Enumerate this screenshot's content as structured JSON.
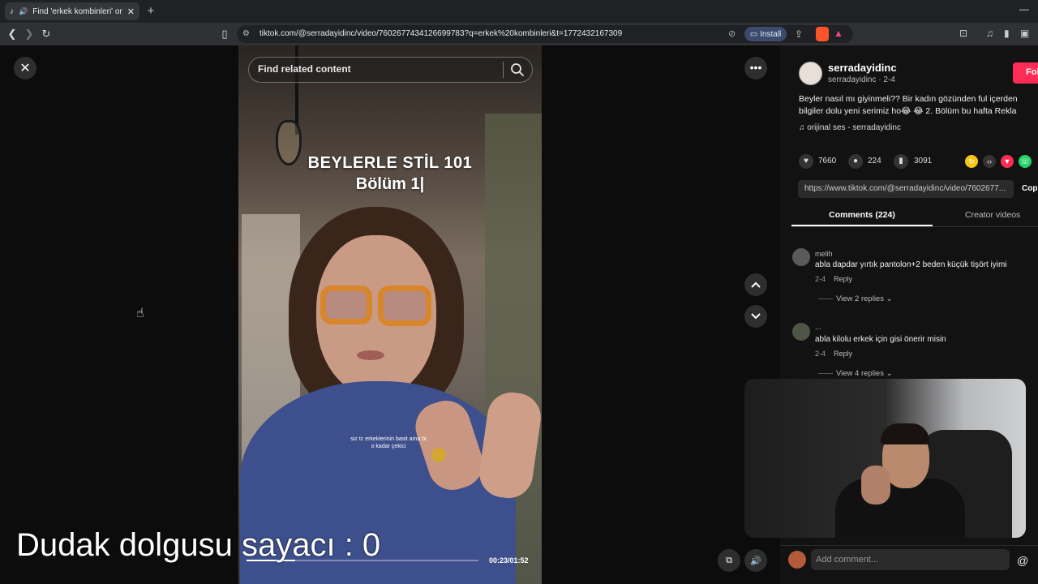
{
  "browser": {
    "tab_title": "Find 'erkek kombinleri' on Tik",
    "new_tab": "+",
    "minimize": "—",
    "url": "tiktok.com/@serradayidinc/video/7602677434126699783?q=erkek%20kombinleri&t=1772432167309",
    "install_label": "Install"
  },
  "search": {
    "placeholder": "Find related content"
  },
  "video": {
    "title_line1": "BEYLERLE STİL 101",
    "title_line2": "Bölüm 1|",
    "subtitle_line1": "siz tc erkeklerinin basit ama bi",
    "subtitle_line2": "o kadar çekici",
    "timecode": "00:23/01:52",
    "progress": 0.21
  },
  "overlay": {
    "text": "Dudak dolgusu  sayacı : 0"
  },
  "creator": {
    "username": "serradayidinc",
    "handle": "serradayidinc · 2-4",
    "follow_label": "Fol",
    "description_line1": "Beyler nasıl mı giyinmeli?? Bir kadın gözünden ful içerden",
    "description_line2": "bilgiler dolu yeni serimiz ho😂 😂 2. Bölüm bu hafta Rekla",
    "music": "♫  orijinal ses - serradayidinc"
  },
  "stats": {
    "likes": "7660",
    "comments": "224",
    "saves": "3091"
  },
  "share": {
    "link": "https://www.tiktok.com/@serradayidinc/video/7602677...",
    "copy_label": "Cop"
  },
  "tabs": {
    "comments": "Comments (224)",
    "creator": "Creator videos"
  },
  "comments": [
    {
      "name": "melih",
      "text": "abla dapdar yırtık pantolon+2 beden küçük tişört iyimi",
      "date": "2-4",
      "reply": "Reply",
      "view_replies": "View 2 replies ⌄"
    },
    {
      "name": "...",
      "text": "abla kilolu erkek için gisi önerir misin",
      "date": "2-4",
      "reply": "Reply",
      "view_replies": "View 4 replies ⌄"
    }
  ],
  "comment_input": {
    "placeholder": "Add comment...",
    "at": "@"
  },
  "colors": {
    "accent": "#fe2c55",
    "panel": "#121212",
    "background": "#000000"
  }
}
